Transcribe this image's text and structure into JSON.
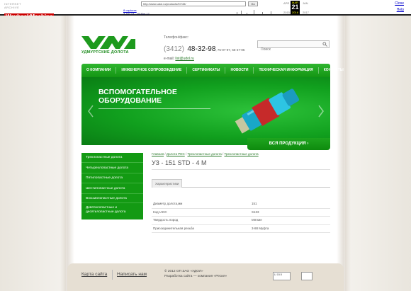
{
  "wayback": {
    "logo_top": "INTERNET ARCHIVE",
    "logo_main": "WaybackMachine",
    "url": "http://www.udol.ru/products/57/45/",
    "go": "Go",
    "captures_count": "8 captures",
    "captures_range": "3 Jan 14 - 15 Mar 17",
    "month_prev": "APR",
    "month_cur": "MAR",
    "month_next": "JAN",
    "day": "21",
    "year_prev": "2015",
    "year_cur": "2016",
    "year_next": "2017",
    "close": "Close",
    "help": "Help"
  },
  "header": {
    "logo_text": "УДМУРТСКИЕ ДОЛОТА",
    "phone_label": "Телефон/факс:",
    "phone_code": "(3412)",
    "phone_main": "48-32-98",
    "phone_extra": ", 75-07-97, 65-47-05",
    "email_label": "e-mail: ",
    "email": "list@udol.ru",
    "search_placeholder": "Поиск"
  },
  "nav": {
    "items": [
      "О КОМПАНИИ",
      "ИНЖЕНЕРНОЕ СОПРОВОЖДЕНИЕ",
      "СЕРТИФИКАТЫ",
      "НОВОСТИ",
      "ТЕХНИЧЕСКАЯ ИНФОРМАЦИЯ",
      "КОНТАКТЫ"
    ]
  },
  "banner": {
    "title_line1": "ВСПОМОГАТЕЛЬНОЕ",
    "title_line2": "ОБОРУДОВАНИЕ",
    "all_products": "ВСЯ ПРОДУКЦИЯ ›"
  },
  "left_menu": {
    "items": [
      "Трехлопастные долота",
      "Четырехлопастные долота",
      "Пятилопастные долота",
      "Шестилопастные долота",
      "Восьмилопастные долота",
      "Девятилопастные и десятилопастные долота"
    ]
  },
  "content": {
    "crumbs": [
      "Главная",
      "Долота PDC",
      "Трехлопастные долота",
      "Трехлопастные долота"
    ],
    "crumb_sep": " / ",
    "title": "УЗ - 151 STD - 4 М",
    "tab": "Характеристики",
    "specs": [
      {
        "key": "Диаметр долота,мм",
        "value": "151"
      },
      {
        "key": "Код IADC",
        "value": "S133"
      },
      {
        "key": "Твердость пород",
        "value": "Мягкие"
      },
      {
        "key": "Присоединительная резьба",
        "value": "3-88 Муфта"
      }
    ]
  },
  "footer": {
    "sitemap": "Карта сайта",
    "write_us": "Написать нам",
    "copy_line1": "© 2012 ОП ЗАО «УДОЛ»",
    "copy_line2": "Разработка сайта — компания «Ресия»",
    "counter_text": "LI 15 8"
  },
  "colors": {
    "brand_green": "#139a13",
    "nav_green": "#1ea51e",
    "footer_bg": "#e6dfd3"
  }
}
